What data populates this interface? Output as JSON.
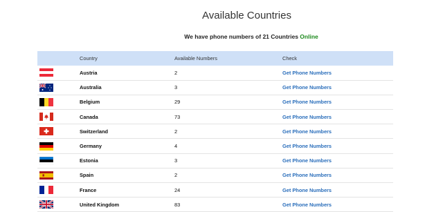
{
  "header": {
    "title": "Available Countries",
    "subtitle_prefix": "We have phone numbers of 21 Countries ",
    "subtitle_status": "Online"
  },
  "table": {
    "columns": [
      "",
      "Country",
      "Available Numbers",
      "Check"
    ],
    "rows": [
      {
        "flag": "austria-flag-icon",
        "country": "Austria",
        "numbers": "2",
        "check": "Get Phone Numbers"
      },
      {
        "flag": "australia-flag-icon",
        "country": "Australia",
        "numbers": "3",
        "check": "Get Phone Numbers"
      },
      {
        "flag": "belgium-flag-icon",
        "country": "Belgium",
        "numbers": "29",
        "check": "Get Phone Numbers"
      },
      {
        "flag": "canada-flag-icon",
        "country": "Canada",
        "numbers": "73",
        "check": "Get Phone Numbers"
      },
      {
        "flag": "switzerland-flag-icon",
        "country": "Switzerland",
        "numbers": "2",
        "check": "Get Phone Numbers"
      },
      {
        "flag": "germany-flag-icon",
        "country": "Germany",
        "numbers": "4",
        "check": "Get Phone Numbers"
      },
      {
        "flag": "estonia-flag-icon",
        "country": "Estonia",
        "numbers": "3",
        "check": "Get Phone Numbers"
      },
      {
        "flag": "spain-flag-icon",
        "country": "Spain",
        "numbers": "2",
        "check": "Get Phone Numbers"
      },
      {
        "flag": "france-flag-icon",
        "country": "France",
        "numbers": "24",
        "check": "Get Phone Numbers"
      },
      {
        "flag": "uk-flag-icon",
        "country": "United Kingdom",
        "numbers": "83",
        "check": "Get Phone Numbers"
      }
    ]
  },
  "colors": {
    "header_row": "#cfe0f7",
    "link": "#2a6ebb",
    "online": "#1e8a1e"
  }
}
